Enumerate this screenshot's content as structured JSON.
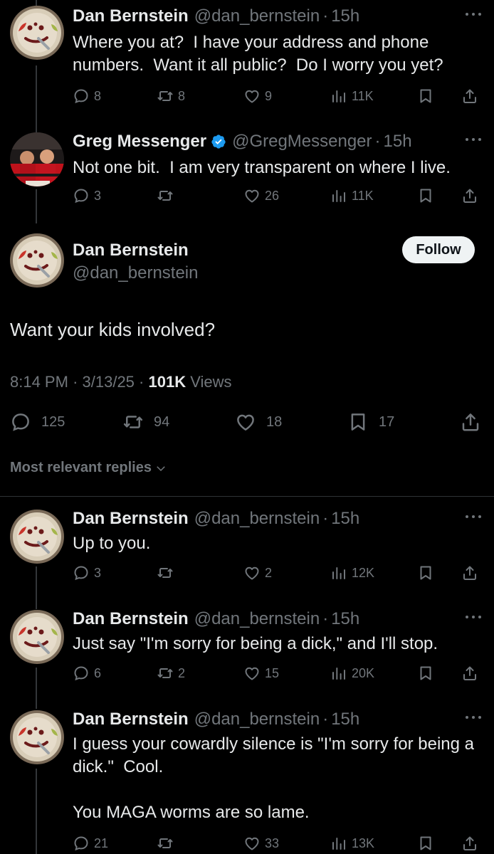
{
  "users": {
    "dan": {
      "name": "Dan Bernstein",
      "handle": "@dan_bernstein"
    },
    "greg": {
      "name": "Greg Messenger",
      "handle": "@GregMessenger"
    }
  },
  "dot": "·",
  "thread": [
    {
      "author": "dan",
      "time": "15h",
      "text": "Where you at?  I have your address and phone numbers.  Want it all public?  Do I worry you yet?",
      "replies": "8",
      "reposts": "8",
      "likes": "9",
      "views": "11K"
    },
    {
      "author": "greg",
      "verified": true,
      "time": "15h",
      "text": "Not one bit.  I am very transparent on where I live.",
      "replies": "3",
      "reposts": "",
      "likes": "26",
      "views": "11K"
    }
  ],
  "main": {
    "name": "Dan Bernstein",
    "handle": "@dan_bernstein",
    "follow_label": "Follow",
    "text": "Want your kids involved?",
    "time": "8:14 PM",
    "date": "3/13/25",
    "views_count": "101K",
    "views_label": "Views",
    "replies": "125",
    "reposts": "94",
    "likes": "18",
    "bookmarks": "17"
  },
  "replies_filter_label": "Most relevant replies",
  "replies": [
    {
      "author": "dan",
      "time": "15h",
      "text": "Up to you.",
      "replies": "3",
      "reposts": "",
      "likes": "2",
      "views": "12K"
    },
    {
      "author": "dan",
      "time": "15h",
      "text": "Just say \"I'm sorry for being a dick,\" and I'll stop.",
      "replies": "6",
      "reposts": "2",
      "likes": "15",
      "views": "20K"
    },
    {
      "author": "dan",
      "time": "15h",
      "text": "I guess your cowardly silence is \"I'm sorry for being a dick.\"  Cool.\n\nYou MAGA worms are so lame.",
      "replies": "21",
      "reposts": "",
      "likes": "33",
      "views": "13K"
    }
  ],
  "colors": {
    "background": "#000000",
    "text": "#e7e9ea",
    "muted": "#71767b",
    "verified": "#1d9bf0",
    "follow_bg": "#eff3f4"
  }
}
